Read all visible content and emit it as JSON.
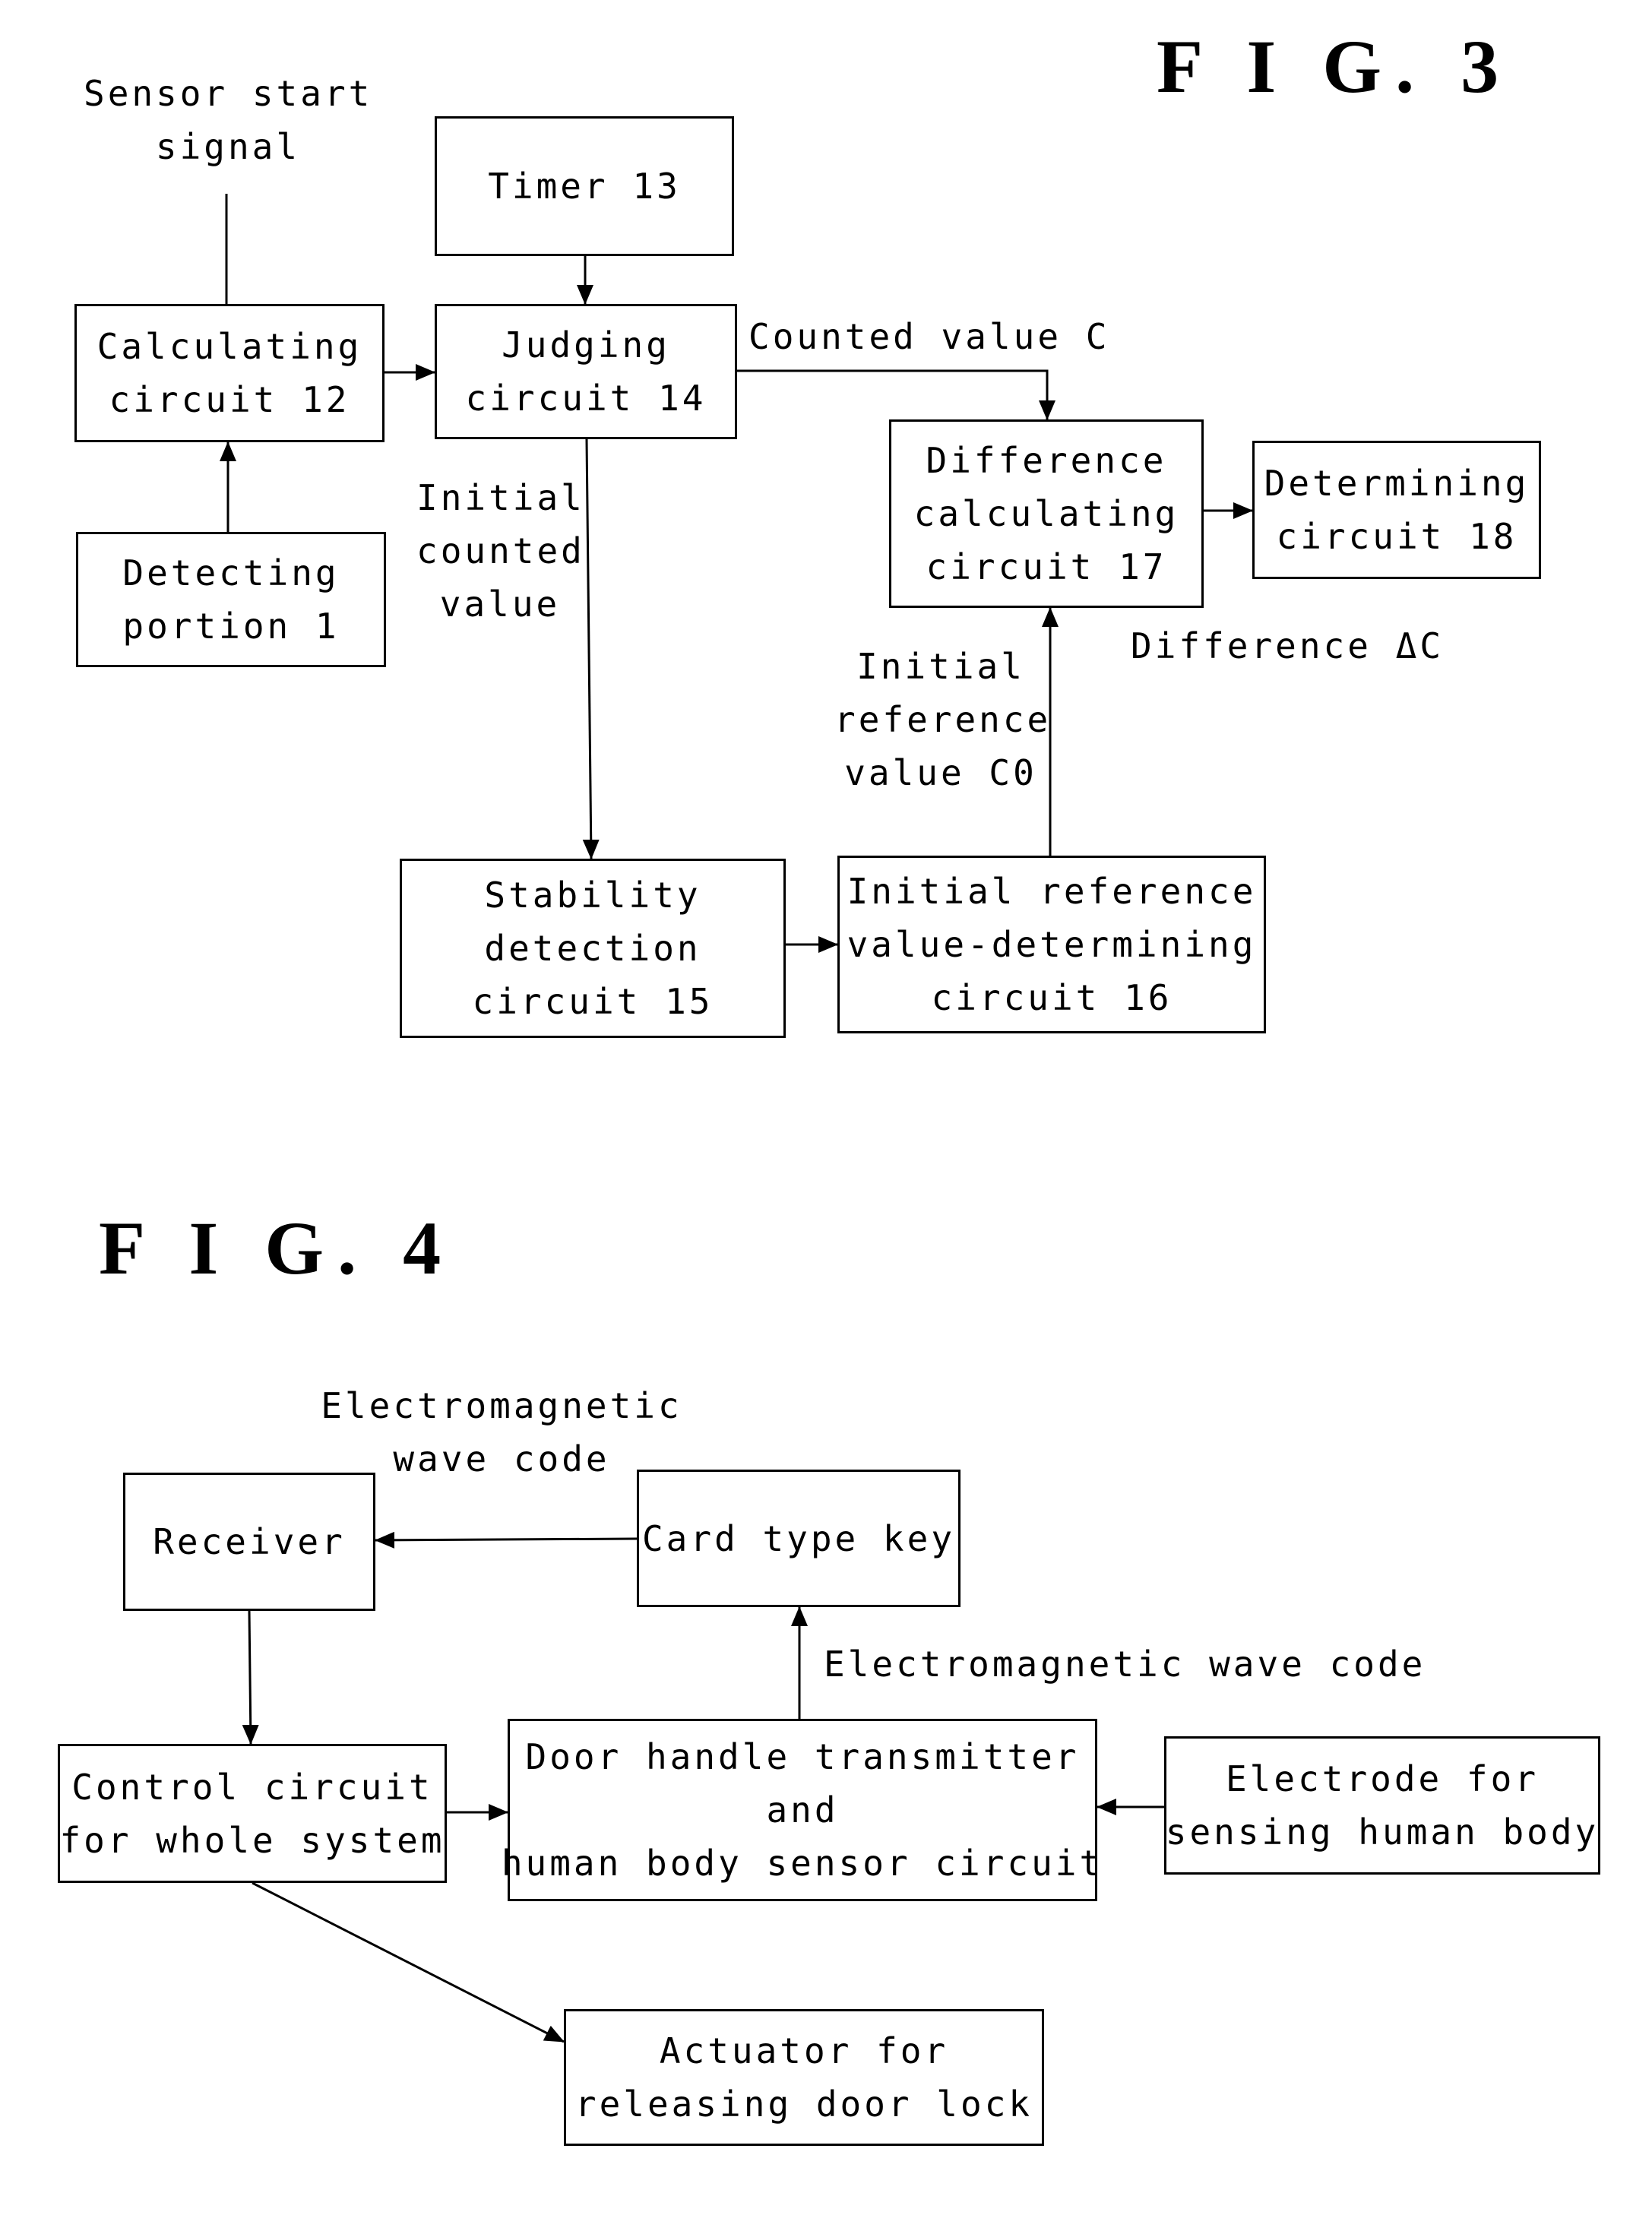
{
  "fig3": {
    "title": "F I G. 3",
    "labels": {
      "sensor_start_1": "Sensor start",
      "sensor_start_2": "signal",
      "counted_value": "Counted value C",
      "initial_counted_1": "Initial",
      "initial_counted_2": "counted",
      "initial_counted_3": "value",
      "initial_ref_1": "Initial",
      "initial_ref_2": "reference",
      "initial_ref_3": "value C0",
      "difference": "Difference ΔC"
    },
    "blocks": {
      "timer": [
        "Timer 13"
      ],
      "calculating": [
        "Calculating",
        "circuit 12"
      ],
      "judging": [
        "Judging",
        "circuit 14"
      ],
      "detecting": [
        "Detecting",
        "portion 1"
      ],
      "difference_calc": [
        "Difference",
        "calculating",
        "circuit 17"
      ],
      "determining": [
        "Determining",
        "circuit 18"
      ],
      "stability": [
        "Stability",
        "detection",
        "circuit 15"
      ],
      "initial_ref_det": [
        "Initial reference",
        "value-determining",
        "circuit 16"
      ]
    }
  },
  "fig4": {
    "title": "F I G. 4",
    "labels": {
      "em_code_top_1": "Electromagnetic",
      "em_code_top_2": "wave code",
      "em_code_mid": "Electromagnetic wave code"
    },
    "blocks": {
      "receiver": [
        "Receiver"
      ],
      "card_key": [
        "Card type key"
      ],
      "control": [
        "Control circuit",
        "for whole system"
      ],
      "door_handle": [
        "Door handle transmitter",
        "and",
        "human body sensor circuit"
      ],
      "electrode": [
        "Electrode for",
        "sensing human body"
      ],
      "actuator": [
        "Actuator for",
        "releasing door lock"
      ]
    }
  }
}
